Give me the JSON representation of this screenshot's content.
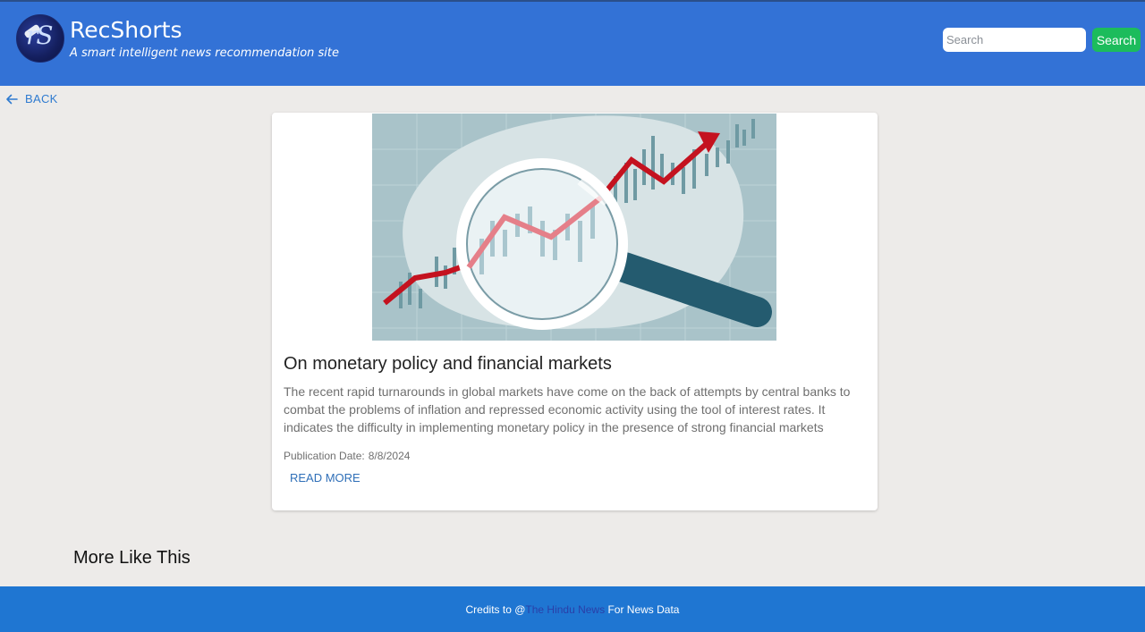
{
  "header": {
    "title": "RecShorts",
    "tagline": "A smart intelligent news recommendation site",
    "search_placeholder": "Search",
    "search_button": "Search",
    "logo_icon": "rs-logo-icon"
  },
  "nav": {
    "back_label": "BACK",
    "back_icon": "arrow-left-icon"
  },
  "article": {
    "title": "On monetary policy and financial markets",
    "description": "The recent rapid turnarounds in global markets have come on the back of attempts by central banks to combat the problems of inflation and repressed economic activity using the tool of interest rates. It indicates the difficulty in implementing monetary policy in the presence of strong financial markets",
    "publication_label": "Publication Date:",
    "publication_date": "8/8/2024",
    "read_more": "READ MORE",
    "image_icon": "magnifier-chart-illustration"
  },
  "more_section": {
    "title": "More Like This"
  },
  "footer": {
    "prefix": "Credits to @",
    "link": "The Hindu News",
    "suffix": " For News Data"
  },
  "colors": {
    "header_bg": "#3372d6",
    "footer_bg": "#1f76d2",
    "search_button_bg": "#1cbc5c",
    "page_bg": "#edebe9",
    "link_blue": "#2f6fb8"
  }
}
